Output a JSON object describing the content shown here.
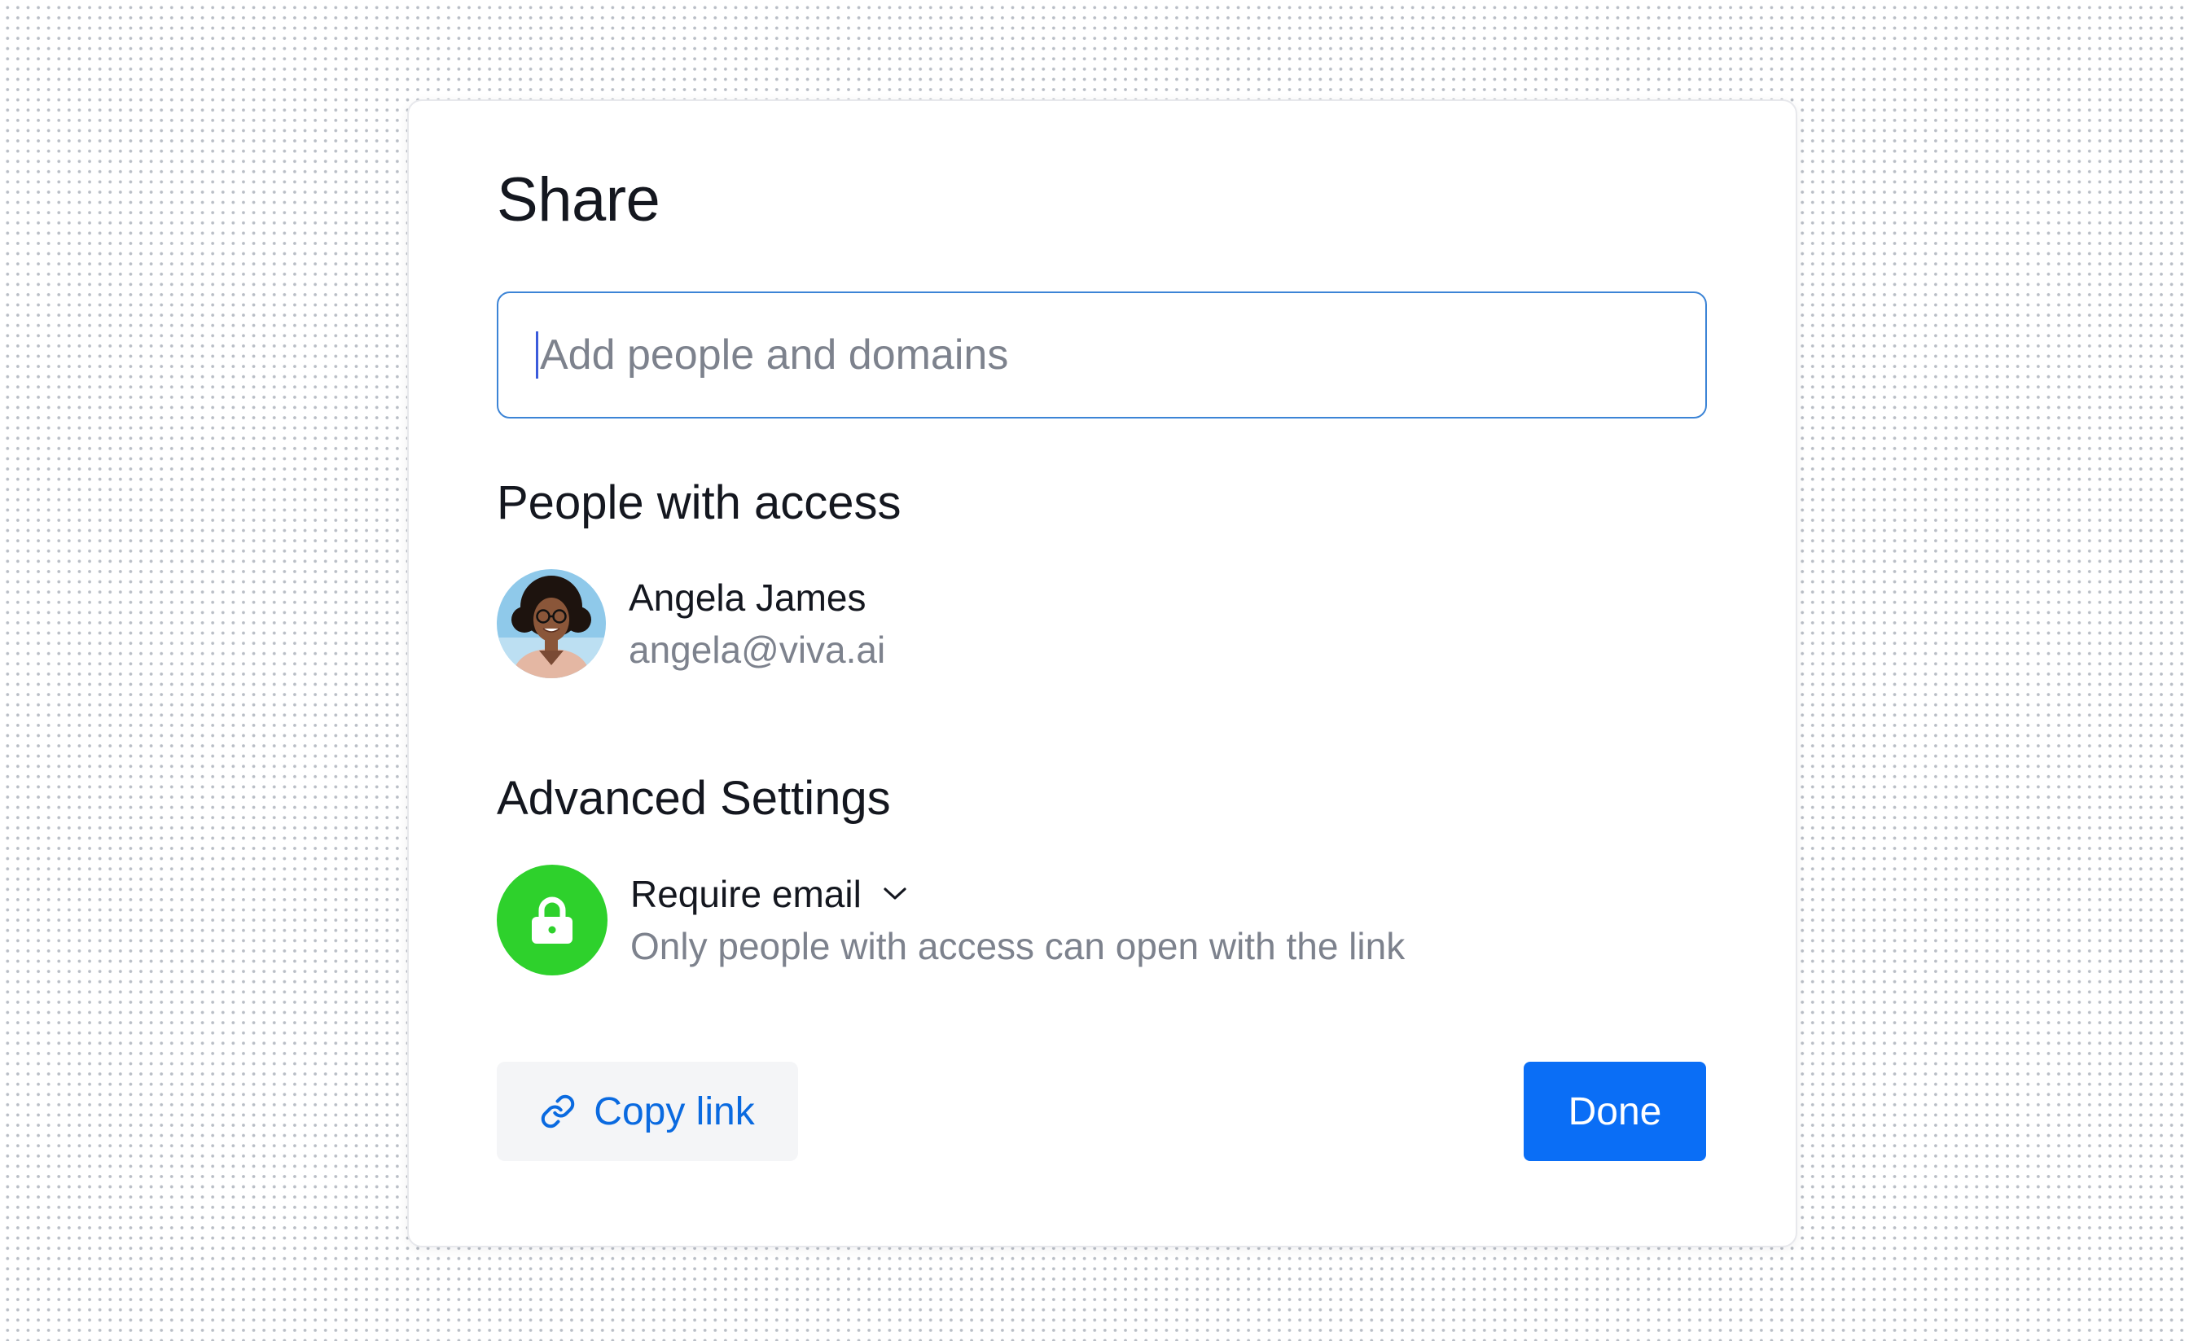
{
  "dialog": {
    "title": "Share"
  },
  "search": {
    "placeholder": "Add people and domains",
    "value": ""
  },
  "people_section": {
    "heading": "People with access",
    "people": [
      {
        "name": "Angela James",
        "email": "angela@viva.ai",
        "avatar_icon": "user-photo"
      }
    ]
  },
  "advanced_settings": {
    "heading": "Advanced Settings",
    "access_setting": {
      "selected": "Require email",
      "description": "Only people with access can open with the link",
      "icon": "lock-icon",
      "icon_bg_color": "#2ed12c"
    }
  },
  "actions": {
    "copy_link_label": "Copy link",
    "copy_link_icon": "link-icon",
    "done_label": "Done"
  },
  "colors": {
    "accent": "#0a6ef6",
    "link_text": "#0a6ae0",
    "input_border": "#3c84d6",
    "success_green": "#2ed12c"
  }
}
